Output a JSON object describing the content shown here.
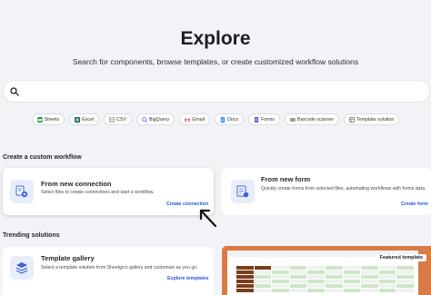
{
  "header": {
    "title": "Explore",
    "subtitle": "Search for components, browse templates, or create customized workflow solutions"
  },
  "search": {
    "value": "",
    "placeholder": ""
  },
  "chips": [
    {
      "label": "Sheets",
      "icon": "sheets-icon",
      "color": "#1e8e3e"
    },
    {
      "label": "Excel",
      "icon": "excel-icon",
      "color": "#217346"
    },
    {
      "label": "CSV",
      "icon": "csv-icon",
      "color": "#5f6368"
    },
    {
      "label": "BigQuery",
      "icon": "bigquery-icon",
      "color": "#4285f4"
    },
    {
      "label": "Gmail",
      "icon": "gmail-icon",
      "color": "#d93025"
    },
    {
      "label": "Docs",
      "icon": "docs-icon",
      "color": "#4285f4"
    },
    {
      "label": "Forms",
      "icon": "forms-icon",
      "color": "#7e57c2"
    },
    {
      "label": "Barcode scanner",
      "icon": "barcode-icon",
      "color": "#333333"
    },
    {
      "label": "Template solution",
      "icon": "template-icon",
      "color": "#5f6368"
    }
  ],
  "custom_workflow": {
    "heading": "Create a custom workflow",
    "cards": [
      {
        "title": "From new connection",
        "description": "Select files to create connections and start a workflow.",
        "link": "Create connection",
        "icon": "connection-icon"
      },
      {
        "title": "From new form",
        "description": "Quickly create forms from selected files, automating workflows with forms data.",
        "link": "Create form",
        "icon": "form-icon"
      }
    ]
  },
  "trending": {
    "heading": "Trending solutions",
    "gallery": {
      "title": "Template gallery",
      "description": "Select a template solution from Sheetgo's gallery and customize as you go.",
      "link": "Explore templates",
      "icon": "layers-icon"
    },
    "featured": {
      "badge": "Featured template"
    }
  },
  "colors": {
    "accent": "#2458d6",
    "background": "#f1f3f6",
    "featured": "#d97b45"
  }
}
